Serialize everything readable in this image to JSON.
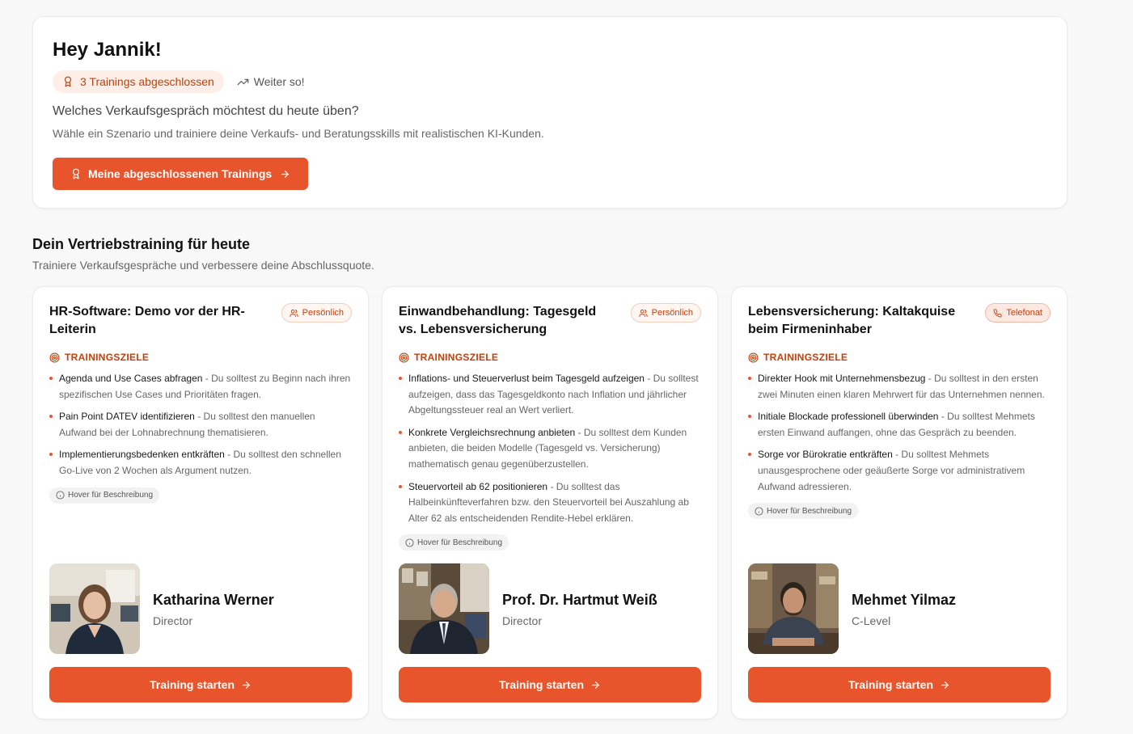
{
  "greeting": "Hey Jannik!",
  "badge_completed": "3 Trainings abgeschlossen",
  "badge_motivation": "Weiter so!",
  "question": "Welches Verkaufsgespräch möchtest du heute üben?",
  "subtitle": "Wähle ein Szenario und trainiere deine Verkaufs- und Beratungsskills mit realistischen KI-Kunden.",
  "completed_button": "Meine abgeschlossenen Trainings",
  "section": {
    "title": "Dein Vertriebstraining für heute",
    "subtitle": "Trainiere Verkaufsgespräche und verbessere deine Abschlussquote."
  },
  "colors": {
    "accent": "#e8552c",
    "accent_text": "#c2410c",
    "tag_bg": "#fdeee8"
  },
  "cards": [
    {
      "title": "HR-Software: Demo vor der HR-Leiterin",
      "tag": "Persönlich",
      "tag_icon": "user-icon",
      "goals_label": "TRAININGSZIELE",
      "goals": [
        {
          "title": "Agenda und Use Cases abfragen",
          "desc": " - Du solltest zu Beginn nach ihren spezifischen Use Cases und Prioritäten fragen."
        },
        {
          "title": "Pain Point DATEV identifizieren",
          "desc": " - Du solltest den manuellen Aufwand bei der Lohnabrechnung thematisieren."
        },
        {
          "title": "Implementierungsbedenken entkräften",
          "desc": " - Du solltest den schnellen Go-Live von 2 Wochen als Argument nutzen."
        }
      ],
      "hover_hint": "Hover für Beschreibung",
      "person_name": "Katharina Werner",
      "person_role": "Director",
      "button": "Training starten"
    },
    {
      "title": "Einwandbehandlung: Tagesgeld vs. Lebensversicherung",
      "tag": "Persönlich",
      "tag_icon": "user-icon",
      "goals_label": "TRAININGSZIELE",
      "goals": [
        {
          "title": "Inflations- und Steuerverlust beim Tagesgeld aufzeigen",
          "desc": " - Du solltest aufzeigen, dass das Tagesgeldkonto nach Inflation und jährlicher Abgeltungssteuer real an Wert verliert."
        },
        {
          "title": "Konkrete Vergleichsrechnung anbieten",
          "desc": " - Du solltest dem Kunden anbieten, die beiden Modelle (Tagesgeld vs. Versicherung) mathematisch genau gegenüberzustellen."
        },
        {
          "title": "Steuervorteil ab 62 positionieren",
          "desc": " - Du solltest das Halbeinkünfteverfahren bzw. den Steuervorteil bei Auszahlung ab Alter 62 als entscheidenden Rendite-Hebel erklären."
        }
      ],
      "hover_hint": "Hover für Beschreibung",
      "person_name": "Prof. Dr. Hartmut Weiß",
      "person_role": "Director",
      "button": "Training starten"
    },
    {
      "title": "Lebensversicherung: Kaltakquise beim Firmeninhaber",
      "tag": "Telefonat",
      "tag_icon": "phone-icon",
      "goals_label": "TRAININGSZIELE",
      "goals": [
        {
          "title": "Direkter Hook mit Unternehmensbezug",
          "desc": " - Du solltest in den ersten zwei Minuten einen klaren Mehrwert für das Unternehmen nennen."
        },
        {
          "title": "Initiale Blockade professionell überwinden",
          "desc": " - Du solltest Mehmets ersten Einwand auffangen, ohne das Gespräch zu beenden."
        },
        {
          "title": "Sorge vor Bürokratie entkräften",
          "desc": " - Du solltest Mehmets unausgesprochene oder geäußerte Sorge vor administrativem Aufwand adressieren."
        }
      ],
      "hover_hint": "Hover für Beschreibung",
      "person_name": "Mehmet Yilmaz",
      "person_role": "C-Level",
      "button": "Training starten"
    }
  ]
}
